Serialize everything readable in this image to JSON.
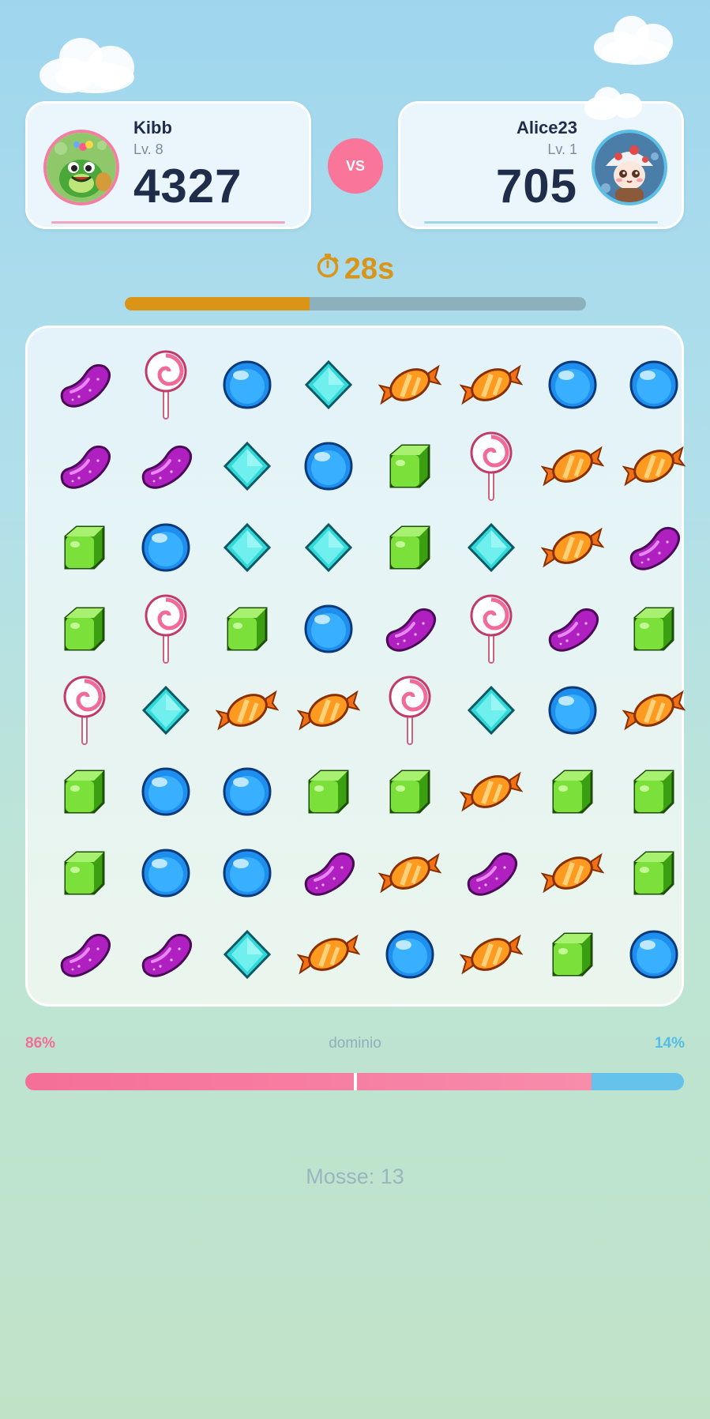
{
  "players": {
    "left": {
      "name": "Kibb",
      "level": "Lv. 8",
      "score": "4327",
      "avatar_icon": "green-monster-avatar-icon",
      "accent": "#f47ea2"
    },
    "right": {
      "name": "Alice23",
      "level": "Lv. 1",
      "score": "705",
      "avatar_icon": "mushroom-girl-avatar-icon",
      "accent": "#5bbfe8"
    }
  },
  "vs_label": "VS",
  "timer": {
    "value": "28s",
    "icon": "stopwatch-icon",
    "progress": 0.4
  },
  "board": {
    "rows": [
      [
        "jelly",
        "lollipop",
        "blue",
        "diamond",
        "orange",
        "orange",
        "blue",
        "blue"
      ],
      [
        "jelly",
        "jelly",
        "diamond",
        "blue",
        "green",
        "lollipop",
        "orange",
        "orange"
      ],
      [
        "green",
        "blue",
        "diamond",
        "diamond",
        "green",
        "diamond",
        "orange",
        "jelly"
      ],
      [
        "green",
        "lollipop",
        "green",
        "blue",
        "jelly",
        "lollipop",
        "jelly",
        "green"
      ],
      [
        "lollipop",
        "diamond",
        "orange",
        "orange",
        "lollipop",
        "diamond",
        "blue",
        "orange"
      ],
      [
        "green",
        "blue",
        "blue",
        "green",
        "green",
        "orange",
        "green",
        "green"
      ],
      [
        "green",
        "blue",
        "blue",
        "jelly",
        "orange",
        "jelly",
        "orange",
        "green"
      ],
      [
        "jelly",
        "jelly",
        "diamond",
        "orange",
        "blue",
        "orange",
        "green",
        "blue"
      ]
    ]
  },
  "domination": {
    "left_label": "86%",
    "title": "dominio",
    "right_label": "14%",
    "left_fraction": 0.86
  },
  "moves_label": "Mosse: 13"
}
